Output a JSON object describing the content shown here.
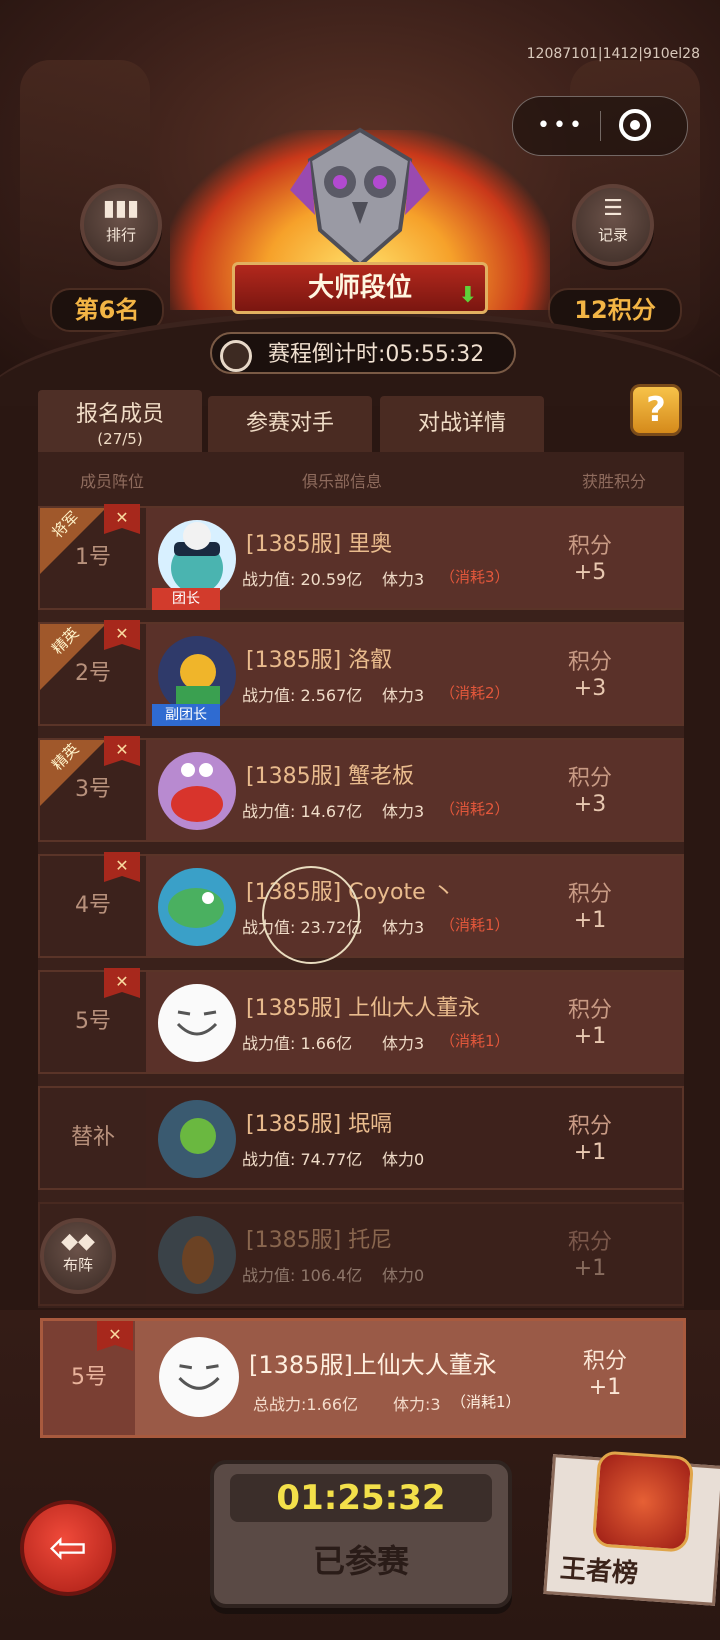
{
  "system": {
    "build_info": "12087101|1412|910el28"
  },
  "header": {
    "rank_button_label": "排行",
    "records_button_label": "记录",
    "placement": "第6名",
    "points_total": "12积分",
    "tier_name": "大师段位",
    "countdown": "赛程倒计时:05:55:32"
  },
  "tabs": [
    {
      "label": "报名成员",
      "sub": "(27/5)"
    },
    {
      "label": "参赛对手"
    },
    {
      "label": "对战详情"
    }
  ],
  "help_label": "?",
  "columns": {
    "lineup": "成员阵位",
    "club": "俱乐部信息",
    "points": "获胜积分"
  },
  "members": [
    {
      "slot": "1号",
      "corner": "将军",
      "name": "[1385服] 里奥",
      "power": "战力值: 20.59亿",
      "stamina": "体力3",
      "cost": "（消耗3）",
      "points_label": "积分",
      "points": "+5",
      "role": "团长"
    },
    {
      "slot": "2号",
      "corner": "精英",
      "name": "[1385服] 洛叡",
      "power": "战力值: 2.567亿",
      "stamina": "体力3",
      "cost": "（消耗2）",
      "points_label": "积分",
      "points": "+3",
      "role": "副团长"
    },
    {
      "slot": "3号",
      "corner": "精英",
      "name": "[1385服] 蟹老板",
      "power": "战力值: 14.67亿",
      "stamina": "体力3",
      "cost": "（消耗2）",
      "points_label": "积分",
      "points": "+3"
    },
    {
      "slot": "4号",
      "name": "[1385服] Coyote 丶",
      "power": "战力值: 23.72亿",
      "stamina": "体力3",
      "cost": "（消耗1）",
      "points_label": "积分",
      "points": "+1"
    },
    {
      "slot": "5号",
      "name": "[1385服] 上仙大人董永",
      "power": "战力值: 1.66亿",
      "stamina": "体力3",
      "cost": "（消耗1）",
      "points_label": "积分",
      "points": "+1"
    },
    {
      "slot": "替补",
      "name": "[1385服] 垊嗝",
      "power": "战力值: 74.77亿",
      "stamina": "体力0",
      "points_label": "积分",
      "points": "+1"
    },
    {
      "slot": "",
      "name": "[1385服] 托尼",
      "power": "战力值: 106.4亿",
      "stamina": "体力0",
      "points_label": "积分",
      "points": "+1"
    }
  ],
  "formation_button_label": "布阵",
  "me": {
    "slot": "5号",
    "name": "[1385服]上仙大人董永",
    "power": "总战力:1.66亿",
    "stamina": "体力:3",
    "cost": "（消耗1）",
    "points_label": "积分",
    "points": "+1"
  },
  "timer": {
    "value": "01:25:32",
    "status": "已参赛"
  },
  "kings_list_label": "王者榜",
  "flag_glyph": "✕",
  "colors": {
    "accent_gold": "#f3b545",
    "cost_red": "#e3573b",
    "timer_yellow": "#f3e04a"
  }
}
